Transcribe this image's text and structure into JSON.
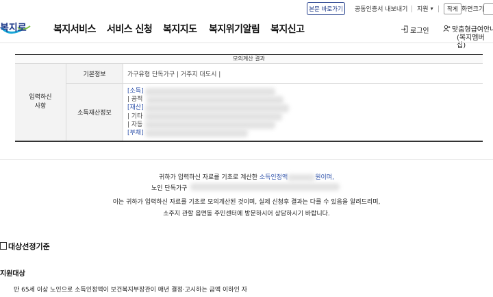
{
  "utility": {
    "skip_link": "본문 바로가기",
    "cert_export": "공동인증서 내보내기",
    "lang": "지원",
    "lang_arrow": "▾",
    "zoom_small": "작게",
    "zoom_label": "화면크기"
  },
  "logo": {
    "text": "복지로"
  },
  "nav": [
    "복지서비스",
    "서비스 신청",
    "복지지도",
    "복지위기알림",
    "복지신고"
  ],
  "header_links": {
    "login": "로그인",
    "member_line1": "맞춤형급여안내",
    "member_line2": "(복지멤버십)"
  },
  "result": {
    "title": "모의계산 결과",
    "side_label": "입력하신\n사항",
    "basic_label": "기본정보",
    "basic_value": "가구유형   단독가구 | 거주지 대도시 |",
    "income_label": "소득재산정보",
    "income_tags": [
      "[소득]",
      "| 공적",
      "[재산]",
      "| 기타",
      "| 자동",
      "[부채]"
    ]
  },
  "message": {
    "line1_a": "귀하가 입력하신 자료를 기초로 계산한 ",
    "line1_link": "소득인정액",
    "line1_b": "원이며,",
    "line2": "노인 단독가구",
    "line3": "이는 귀하가 입력하신 자료를 기초로 모의계산된 것이며, 실제 신청후 결과는 다를 수 있음을 알려드리며,",
    "line4": "소주지 관할 읍면동 주민센터에 방문하시어 상담하시기 바랍니다."
  },
  "criteria": {
    "title": "대상선정기준",
    "subtitle": "지원대상",
    "desc": "만 65세 이상 노인으로 소득인정액이 보건복지부장관이 매년 결정·고시하는 금액 이하인 자"
  },
  "colors": {
    "brand_blue": "#1f3b8a",
    "link_blue": "#2b4fa8",
    "logo_cyan": "#19a7d8"
  }
}
